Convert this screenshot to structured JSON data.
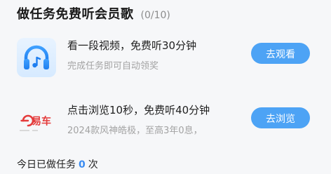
{
  "header": {
    "title": "做任务免费听会员歌",
    "progress": "(0/10)"
  },
  "tasks": [
    {
      "icon": "headphones-music-icon",
      "title": "看一段视频，免费听30分钟",
      "desc": "完成任务即可自动领奖",
      "button": "去观看"
    },
    {
      "icon": "yiche-logo",
      "logo_text": "易车",
      "title": "点击浏览10秒，免费听40分钟",
      "desc": "2024款风神皓极，至高3年0息，",
      "button": "去浏览"
    }
  ],
  "footer": {
    "prefix": "今日已做任务",
    "count": "0",
    "suffix": "次"
  },
  "colors": {
    "accent": "#4da3f5",
    "count": "#3b8cf1"
  }
}
